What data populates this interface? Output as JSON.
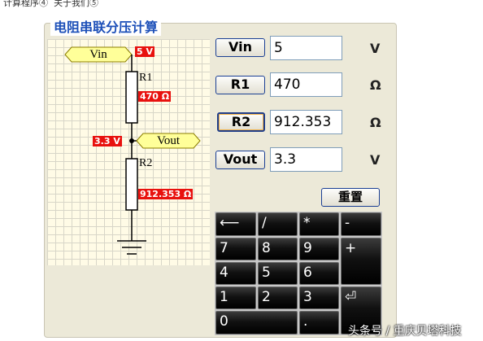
{
  "top_menu": [
    "计算程序④",
    "关于我们⑤"
  ],
  "title": "电阻串联分压计算",
  "circuit": {
    "vin_tag": "Vin",
    "vin_value": "5 V",
    "r1_name": "R1",
    "r1_value": "470 Ω",
    "vout_tag": "Vout",
    "vout_value": "3.3 V",
    "r2_name": "R2",
    "r2_value": "912.353 Ω"
  },
  "rows": [
    {
      "label": "Vin",
      "value": "5",
      "unit": "V"
    },
    {
      "label": "R1",
      "value": "470",
      "unit": "Ω"
    },
    {
      "label": "R2",
      "value": "912.353",
      "unit": "Ω"
    },
    {
      "label": "Vout",
      "value": "3.3",
      "unit": "V"
    }
  ],
  "reset_label": "重置",
  "keypad": {
    "backspace": "⟵",
    "divide": "/",
    "multiply": "*",
    "minus": "-",
    "k7": "7",
    "k8": "8",
    "k9": "9",
    "plus": "+",
    "k4": "4",
    "k5": "5",
    "k6": "6",
    "k1": "1",
    "k2": "2",
    "k3": "3",
    "enter": "⏎",
    "k0": "0",
    "dot": "."
  },
  "watermark": "头条号 / 重庆贝塔科技"
}
